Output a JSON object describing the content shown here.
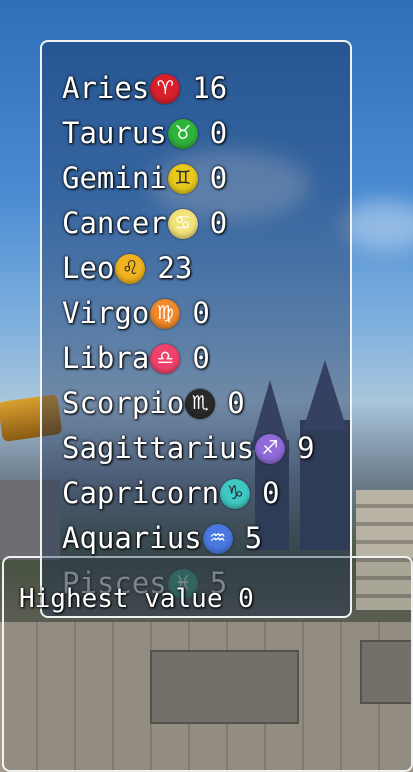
{
  "zodiac_list": [
    {
      "name": "Aries",
      "value": "16",
      "glyph": "♈",
      "color": "#d8202c",
      "icon": "aries-icon"
    },
    {
      "name": "Taurus",
      "value": "0",
      "glyph": "♉",
      "color": "#2fb43a",
      "icon": "taurus-icon"
    },
    {
      "name": "Gemini",
      "value": "0",
      "glyph": "♊",
      "color": "#e8c81c",
      "icon": "gemini-icon"
    },
    {
      "name": "Cancer",
      "value": "0",
      "glyph": "♋",
      "color": "#f2e27a",
      "icon": "cancer-icon"
    },
    {
      "name": "Leo",
      "value": "23",
      "glyph": "♌",
      "color": "#f0b21e",
      "icon": "leo-icon"
    },
    {
      "name": "Virgo",
      "value": "0",
      "glyph": "♍",
      "color": "#f08a2a",
      "icon": "virgo-icon"
    },
    {
      "name": "Libra",
      "value": "0",
      "glyph": "♎",
      "color": "#f0426a",
      "icon": "libra-icon"
    },
    {
      "name": "Scorpio",
      "value": "0",
      "glyph": "♏",
      "color": "#2a2a2a",
      "icon": "scorpio-icon"
    },
    {
      "name": "Sagittarius",
      "value": "9",
      "glyph": "♐",
      "color": "#8f6ad8",
      "icon": "sagittarius-icon"
    },
    {
      "name": "Capricorn",
      "value": "0",
      "glyph": "♑",
      "color": "#3ec9c4",
      "icon": "capricorn-icon"
    },
    {
      "name": "Aquarius",
      "value": "5",
      "glyph": "♒",
      "color": "#4a78e0",
      "icon": "aquarius-icon"
    },
    {
      "name": "Pisces",
      "value": "5",
      "glyph": "♓",
      "color": "#2aa28a",
      "icon": "pisces-icon"
    }
  ],
  "highest": {
    "label": "Highest value",
    "value": "0"
  }
}
